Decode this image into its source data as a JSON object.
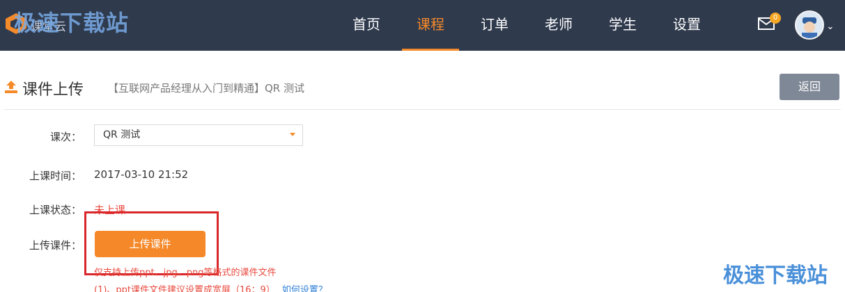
{
  "topbar": {
    "brand": "课堂云",
    "watermark": "极速下载站",
    "nav": [
      "首页",
      "课程",
      "订单",
      "老师",
      "学生",
      "设置"
    ],
    "active_nav": "课程",
    "mail_badge": "0"
  },
  "header": {
    "title": "课件上传",
    "course": "【互联网产品经理从入门到精通】QR 测试",
    "back_label": "返回"
  },
  "form": {
    "lesson_label": "课次：",
    "lesson_value": "QR 测试",
    "time_label": "上课时间：",
    "time_value": "2017-03-10 21:52",
    "status_label": "上课状态：",
    "status_value": "未上课",
    "upload_label": "上传课件：",
    "upload_button": "上传课件",
    "hint1": "仅支持上传ppt、jpg、png等格式的课件文件",
    "hint2": "(1)、ppt课件文件建议设置成宽屏（16：9）",
    "hint2_link": "如何设置？"
  },
  "watermark_bottom": "极速下载站",
  "colors": {
    "topbar": "#2f3a4d",
    "accent": "#f58a2a",
    "status_red": "#e84a3f",
    "back_button": "#7f8896"
  }
}
